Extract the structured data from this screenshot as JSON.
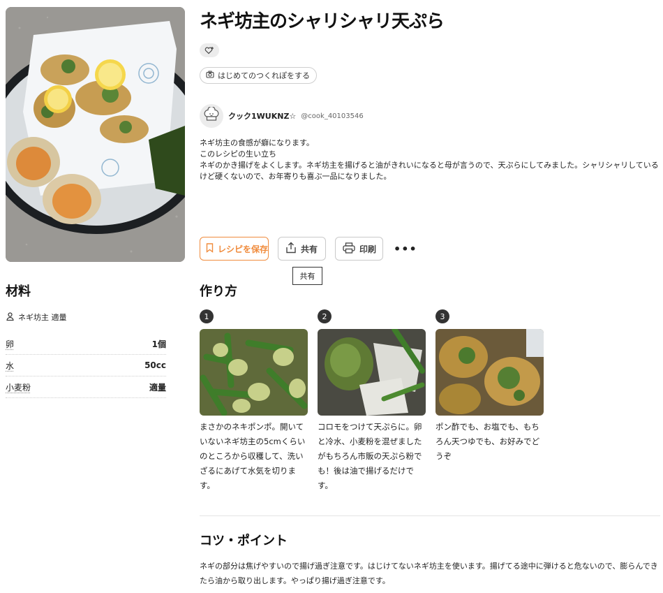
{
  "recipe": {
    "title": "ネギ坊主のシャリシャリ天ぷら",
    "tsukurepo_label": "はじめてのつくれぽをする",
    "author": {
      "name": "クック1WUKNZ☆",
      "handle": "@cook_40103546"
    },
    "description": [
      "ネギ坊主の食感が癖になります。",
      "このレシピの生い立ち",
      "ネギのかき揚げをよくします。ネギ坊主を揚げると油がきれいになると母が言うので、天ぷらにしてみました。シャリシャリしているけど硬くないので、お年寄りも喜ぶ一品になりました。"
    ]
  },
  "actions": {
    "save_label": "レシピを保存",
    "share_label": "共有",
    "print_label": "印刷",
    "more_label": "•••",
    "tooltip": "共有"
  },
  "ingredients": {
    "heading": "材料",
    "servings": "ネギ坊主 適量",
    "items": [
      {
        "name": "卵",
        "qty": "1個"
      },
      {
        "name": "水",
        "qty": "50cc"
      },
      {
        "name": "小麦粉",
        "qty": "適量"
      }
    ]
  },
  "steps": {
    "heading": "作り方",
    "items": [
      {
        "num": "1",
        "text": "まさかのネキポンポ。開いていないネギ坊主の5cmくらいのところから収穫して、洗いざるにあげて水気を切ります。"
      },
      {
        "num": "2",
        "text": "コロモをつけて天ぷらに。卵と冷水、小麦粉を混ぜましたがもちろん市販の天ぷら粉でも！後は油で揚げるだけです。"
      },
      {
        "num": "3",
        "text": "ポン酢でも、お塩でも、もちろん天つゆでも、お好みでどうぞ"
      }
    ]
  },
  "tips": {
    "heading": "コツ・ポイント",
    "text": "ネギの部分は焦げやすいので揚げ過ぎ注意です。はじけてないネギ坊主を使います。揚げてる途中に弾けると危ないので、膨らんできたら油から取り出します。やっぱり揚げ過ぎ注意です。"
  },
  "colors": {
    "accent": "#f08b3c",
    "text": "#222222",
    "border": "#c9c9c9"
  }
}
